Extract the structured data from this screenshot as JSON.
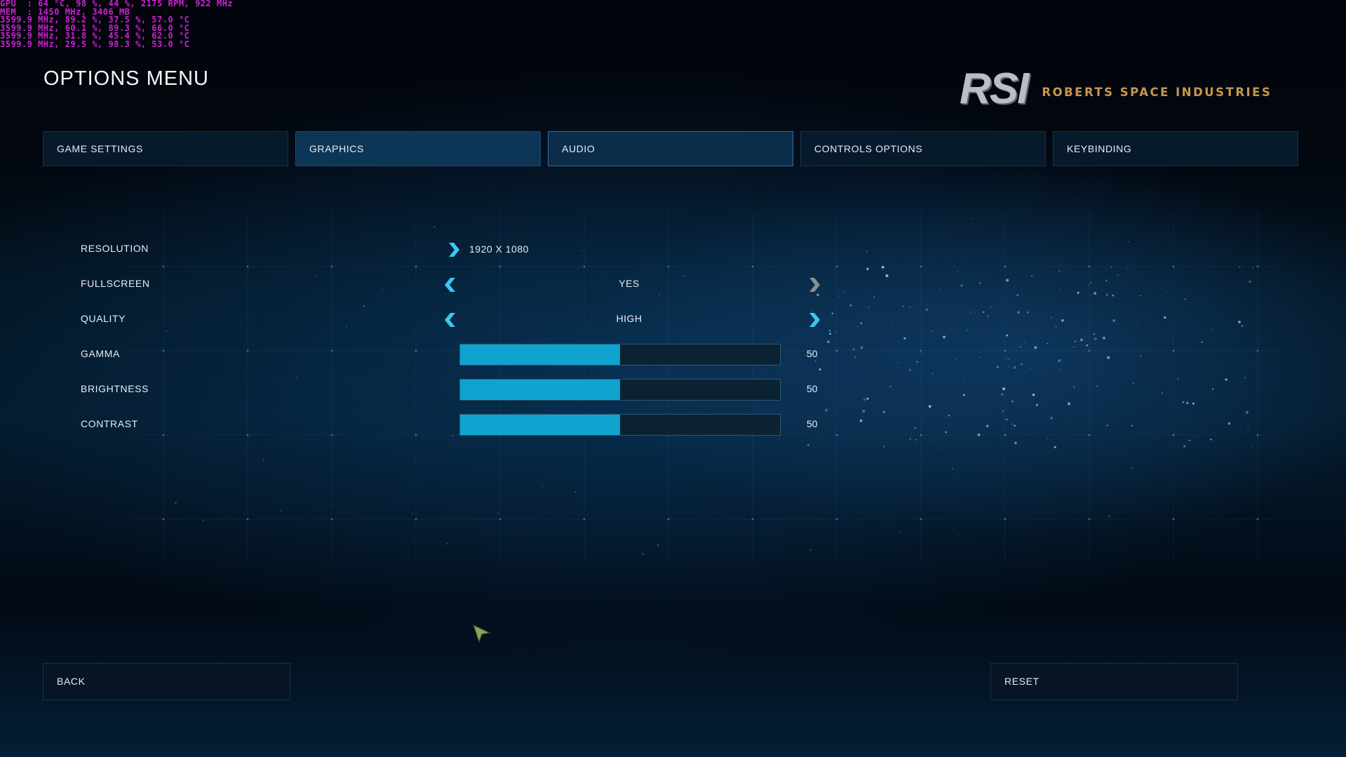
{
  "overlay": {
    "lines": [
      "GPU  : 64 °C, 98 %, 44 %, 2175 RPM, 922 MHz",
      "MEM  : 1450 MHz, 3406 MB",
      "3599.9 MHz, 89.2 %, 37.5 %, 57.0 °C",
      "3599.9 MHz, 60.1 %, 89.3 %, 66.0 °C",
      "3599.9 MHz, 31.8 %, 45.4 %, 62.0 °C",
      "3599.9 MHz, 29.5 %, 98.3 %, 53.0 °C"
    ]
  },
  "header": {
    "title": "OPTIONS MENU",
    "logo_mark": "RSI",
    "logo_text": "ROBERTS SPACE INDUSTRIES"
  },
  "tabs": [
    {
      "label": "GAME SETTINGS"
    },
    {
      "label": "GRAPHICS"
    },
    {
      "label": "AUDIO"
    },
    {
      "label": "CONTROLS OPTIONS"
    },
    {
      "label": "KEYBINDING"
    }
  ],
  "settings": {
    "resolution": {
      "label": "RESOLUTION",
      "value": "1920 X 1080"
    },
    "fullscreen": {
      "label": "FULLSCREEN",
      "value": "YES"
    },
    "quality": {
      "label": "QUALITY",
      "value": "HIGH"
    },
    "gamma": {
      "label": "GAMMA",
      "value": "50",
      "fraction": 0.5
    },
    "brightness": {
      "label": "BRIGHTNESS",
      "value": "50",
      "fraction": 0.5
    },
    "contrast": {
      "label": "CONTRAST",
      "value": "50",
      "fraction": 0.5
    }
  },
  "footer": {
    "back_label": "BACK",
    "reset_label": "RESET"
  },
  "colors": {
    "accent": "#0fa3d0",
    "arrow_active": "#38c8f0",
    "arrow_inactive": "#8a8f95",
    "logo_text": "#c8964e",
    "overlay": "#d020d8"
  }
}
